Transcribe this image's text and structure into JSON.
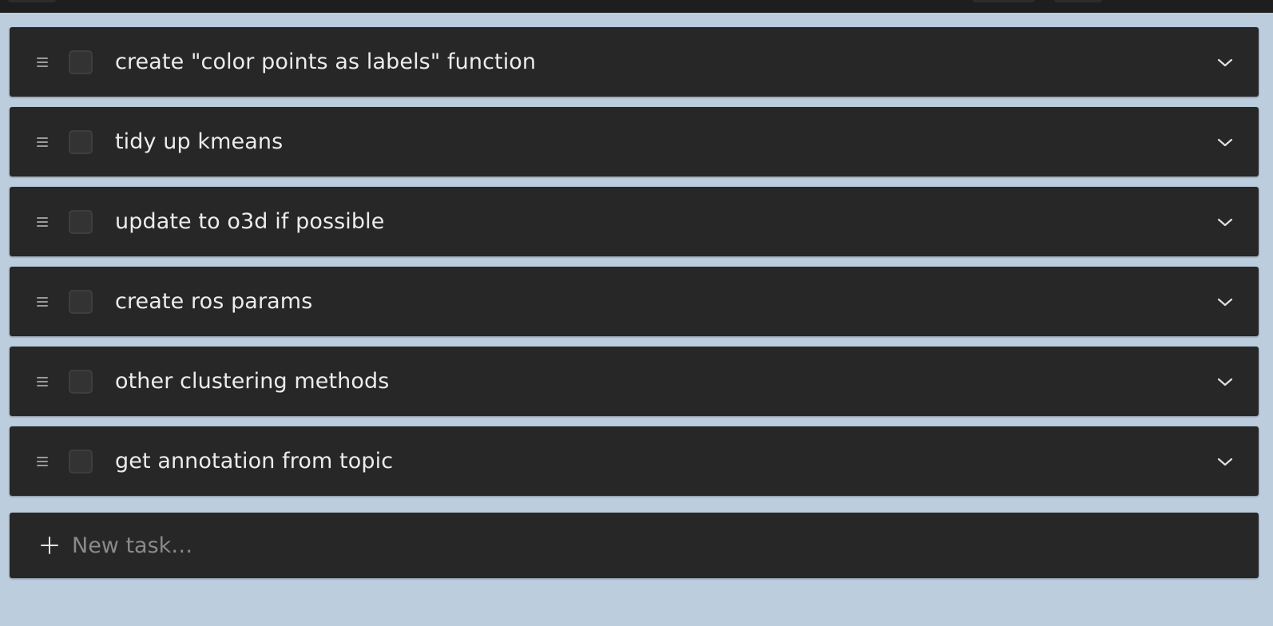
{
  "tasks": [
    {
      "title": "create \"color points as labels\" function",
      "done": false
    },
    {
      "title": "tidy up kmeans",
      "done": false
    },
    {
      "title": "update to o3d if possible",
      "done": false
    },
    {
      "title": "create ros params",
      "done": false
    },
    {
      "title": "other clustering methods",
      "done": false
    },
    {
      "title": "get annotation from topic",
      "done": false
    }
  ],
  "new_task": {
    "value": "",
    "placeholder": "New task…"
  },
  "icons": {
    "drag": "drag-handle-icon",
    "expand": "chevron-down-icon",
    "add": "plus-icon"
  },
  "colors": {
    "background": "#bccdde",
    "card": "#272727",
    "text": "#ececec",
    "placeholder": "#8a8a8a"
  }
}
